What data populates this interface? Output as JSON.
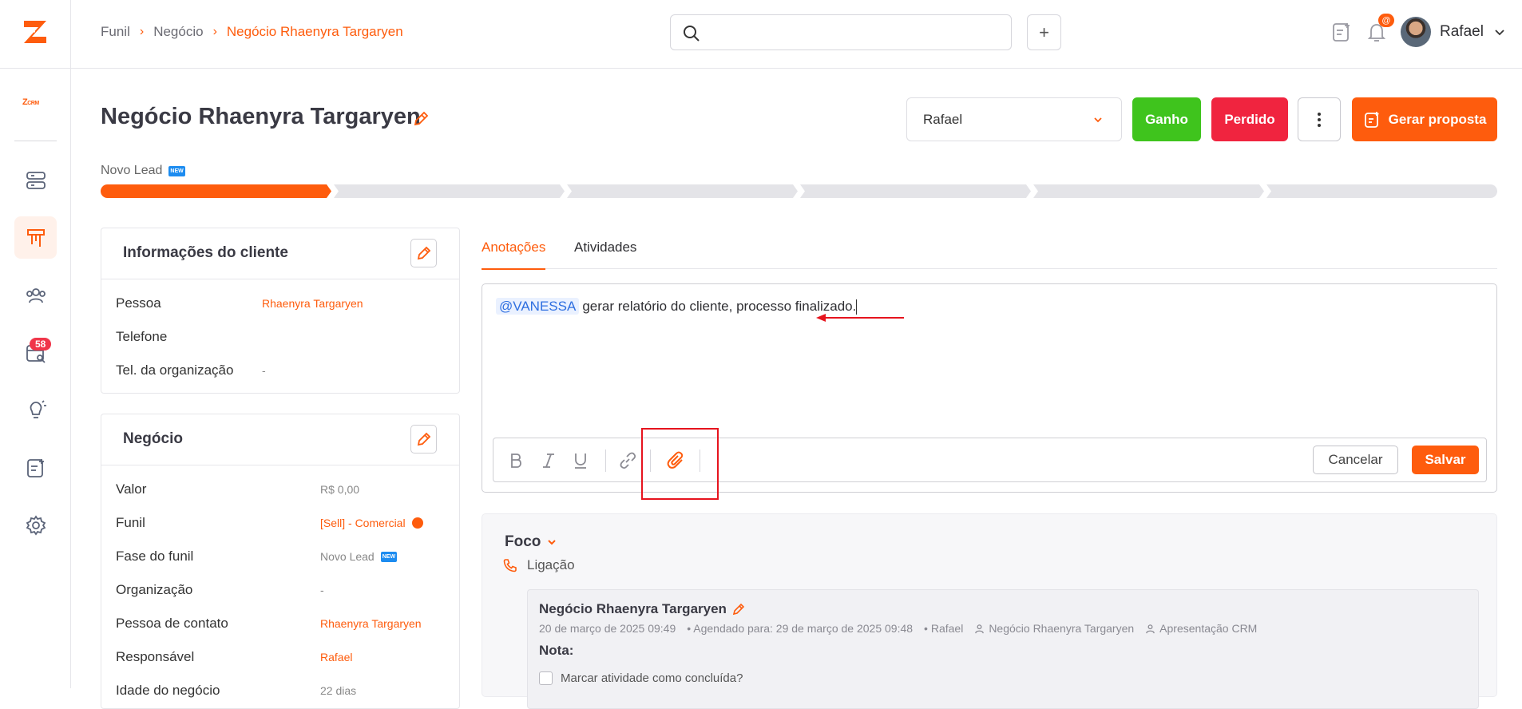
{
  "colors": {
    "accent": "#fe5c0d",
    "won": "#3fc41d",
    "lost": "#f0243f",
    "mention": "#2f6fe0",
    "highlight_box": "#e6141e"
  },
  "sidebar": {
    "brand": "Z",
    "crm_badge": "CRM",
    "items": [
      {
        "icon": "server-stack-icon"
      },
      {
        "icon": "funnel-icon",
        "active": true
      },
      {
        "icon": "users-icon"
      },
      {
        "icon": "calendar-search-icon",
        "badge": "58"
      },
      {
        "icon": "lightbulb-icon"
      },
      {
        "icon": "note-add-icon"
      },
      {
        "icon": "gear-icon"
      }
    ]
  },
  "topbar": {
    "breadcrumb": [
      "Funil",
      "Negócio",
      "Negócio Rhaenyra Targaryen"
    ],
    "search_placeholder": "",
    "add_label": "+",
    "notif_badge": "@",
    "user_name": "Rafael"
  },
  "header": {
    "title": "Negócio Rhaenyra Targaryen",
    "owner_select": "Rafael",
    "won_label": "Ganho",
    "lost_label": "Perdido",
    "proposal_label": "Gerar proposta",
    "stage_label": "Novo Lead",
    "new_tag": "NEW",
    "pipeline_stages": 6,
    "pipeline_current": 1
  },
  "client_card": {
    "title": "Informações do cliente",
    "rows": [
      {
        "key": "Pessoa",
        "value": "Rhaenyra Targaryen",
        "link": true
      },
      {
        "key": "Telefone",
        "value": ""
      },
      {
        "key": "Tel. da organização",
        "value": "-"
      }
    ]
  },
  "deal_card": {
    "title": "Negócio",
    "rows": [
      {
        "key": "Valor",
        "value": "R$ 0,00"
      },
      {
        "key": "Funil",
        "value": "[Sell] - Comercial",
        "link": true
      },
      {
        "key": "Fase do funil",
        "value": "Novo Lead"
      },
      {
        "key": "Organização",
        "value": "-"
      },
      {
        "key": "Pessoa de contato",
        "value": "Rhaenyra Targaryen",
        "link": true
      },
      {
        "key": "Responsável",
        "value": "Rafael",
        "link": true
      },
      {
        "key": "Idade do negócio",
        "value": "22 dias"
      }
    ]
  },
  "tabs": [
    {
      "label": "Anotações",
      "active": true
    },
    {
      "label": "Atividades",
      "active": false
    }
  ],
  "editor": {
    "mention": "@VANESSA",
    "text": "gerar relatório do cliente, processo finalizado.",
    "cancel_label": "Cancelar",
    "save_label": "Salvar"
  },
  "activity": {
    "group": "Foco",
    "type": "Ligação",
    "title": "Negócio Rhaenyra Targaryen",
    "date": "20 de março de 2025 09:49",
    "scheduled": "• Agendado para: 29 de março de 2025 09:48",
    "owner": "• Rafael",
    "deal": "Negócio Rhaenyra Targaryen",
    "product": "Apresentação CRM",
    "note_label": "Nota:",
    "complete_label": "Marcar atividade como concluída?"
  }
}
